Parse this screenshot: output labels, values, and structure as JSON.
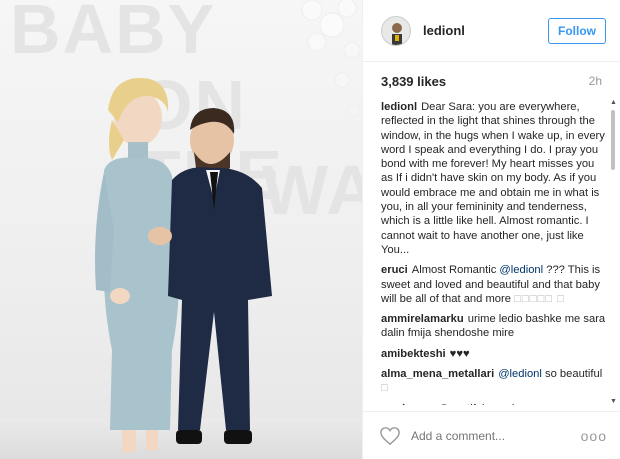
{
  "photo": {
    "background_text": [
      "BABY",
      "ON THE",
      "WAY"
    ]
  },
  "post": {
    "username": "ledionl",
    "follow_label": "Follow",
    "likes": "3,839 likes",
    "time": "2h"
  },
  "comments": [
    {
      "user": "ledionl",
      "parts": [
        {
          "t": "Dear Sara: you are everywhere, reflected in the light that shines through the window, in the hugs when I wake up, in every word I speak and everything I do. I pray you bond with me forever! My heart misses you as If i didn't have skin on my body. As if you would embrace me and obtain me in what is you, in all your femininity and tenderness, which is a little like hell. Almost romantic. I cannot wait to have another one, just like You..."
        }
      ]
    },
    {
      "user": "eruci",
      "parts": [
        {
          "t": "Almost Romantic "
        },
        {
          "m": "@ledionl"
        },
        {
          "t": " ??? This is sweet and loved and beautiful and that baby will be all of that and more "
        },
        {
          "x": "□□□□□ □"
        }
      ]
    },
    {
      "user": "ammirelamarku",
      "parts": [
        {
          "t": "urime ledio bashke me sara dalin fmija shendoshe mire"
        }
      ]
    },
    {
      "user": "amibekteshi",
      "parts": [
        {
          "t": "♥♥♥"
        }
      ]
    },
    {
      "user": "alma_mena_metallari",
      "parts": [
        {
          "m": "@ledionl"
        },
        {
          "t": " so beautiful "
        },
        {
          "x": "□"
        }
      ]
    },
    {
      "user": "_weloveee",
      "parts": [
        {
          "t": "Beautiful couple "
        },
        {
          "x": "□□□□"
        }
      ]
    }
  ],
  "footer": {
    "add_comment_placeholder": "Add a comment...",
    "more_label": "ooo"
  },
  "icons": {
    "like": "heart-icon",
    "more": "more-options-icon"
  },
  "colors": {
    "accent": "#3897f0",
    "mention": "#003569",
    "text": "#262626",
    "muted": "#999999"
  }
}
